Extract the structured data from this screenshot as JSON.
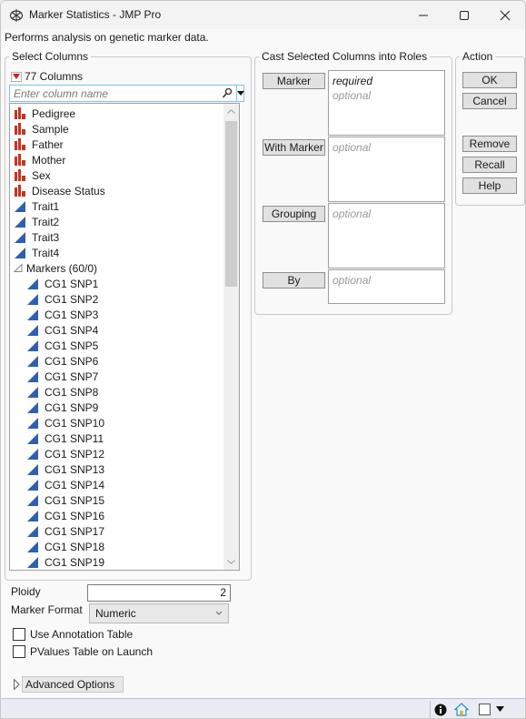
{
  "window": {
    "title": "Marker Statistics - JMP Pro",
    "icons": {
      "app": "jmp-dna-icon",
      "minimize": "minimize-icon",
      "maximize": "maximize-icon",
      "close": "close-icon"
    }
  },
  "subtitle": "Performs analysis on genetic marker data.",
  "select_columns": {
    "legend": "Select Columns",
    "count_label": "77 Columns",
    "search_placeholder": "Enter column name",
    "columns": [
      {
        "name": "Pedigree",
        "type": "nominal",
        "indent": 0
      },
      {
        "name": "Sample",
        "type": "nominal",
        "indent": 0
      },
      {
        "name": "Father",
        "type": "nominal",
        "indent": 0
      },
      {
        "name": "Mother",
        "type": "nominal",
        "indent": 0
      },
      {
        "name": "Sex",
        "type": "nominal",
        "indent": 0
      },
      {
        "name": "Disease Status",
        "type": "nominal",
        "indent": 0
      },
      {
        "name": "Trait1",
        "type": "continuous",
        "indent": 0
      },
      {
        "name": "Trait2",
        "type": "continuous",
        "indent": 0
      },
      {
        "name": "Trait3",
        "type": "continuous",
        "indent": 0
      },
      {
        "name": "Trait4",
        "type": "continuous",
        "indent": 0
      },
      {
        "name": "Markers (60/0)",
        "type": "group",
        "indent": 0
      },
      {
        "name": "CG1 SNP1",
        "type": "continuous",
        "indent": 1
      },
      {
        "name": "CG1 SNP2",
        "type": "continuous",
        "indent": 1
      },
      {
        "name": "CG1 SNP3",
        "type": "continuous",
        "indent": 1
      },
      {
        "name": "CG1 SNP4",
        "type": "continuous",
        "indent": 1
      },
      {
        "name": "CG1 SNP5",
        "type": "continuous",
        "indent": 1
      },
      {
        "name": "CG1 SNP6",
        "type": "continuous",
        "indent": 1
      },
      {
        "name": "CG1 SNP7",
        "type": "continuous",
        "indent": 1
      },
      {
        "name": "CG1 SNP8",
        "type": "continuous",
        "indent": 1
      },
      {
        "name": "CG1 SNP9",
        "type": "continuous",
        "indent": 1
      },
      {
        "name": "CG1 SNP10",
        "type": "continuous",
        "indent": 1
      },
      {
        "name": "CG1 SNP11",
        "type": "continuous",
        "indent": 1
      },
      {
        "name": "CG1 SNP12",
        "type": "continuous",
        "indent": 1
      },
      {
        "name": "CG1 SNP13",
        "type": "continuous",
        "indent": 1
      },
      {
        "name": "CG1 SNP14",
        "type": "continuous",
        "indent": 1
      },
      {
        "name": "CG1 SNP15",
        "type": "continuous",
        "indent": 1
      },
      {
        "name": "CG1 SNP16",
        "type": "continuous",
        "indent": 1
      },
      {
        "name": "CG1 SNP17",
        "type": "continuous",
        "indent": 1
      },
      {
        "name": "CG1 SNP18",
        "type": "continuous",
        "indent": 1
      },
      {
        "name": "CG1 SNP19",
        "type": "continuous",
        "indent": 1
      }
    ]
  },
  "cast_roles": {
    "legend": "Cast Selected Columns into Roles",
    "roles": [
      {
        "button": "Marker",
        "required": "required",
        "optional": "optional"
      },
      {
        "button": "With Marker",
        "required": "",
        "optional": "optional"
      },
      {
        "button": "Grouping",
        "required": "",
        "optional": "optional"
      },
      {
        "button": "By",
        "required": "",
        "optional": "optional"
      }
    ]
  },
  "action": {
    "legend": "Action",
    "buttons": [
      "OK",
      "Cancel",
      "Remove",
      "Recall",
      "Help"
    ]
  },
  "options": {
    "ploidy_label": "Ploidy",
    "ploidy_value": "2",
    "marker_format_label": "Marker Format",
    "marker_format_value": "Numeric",
    "use_annotation_label": "Use Annotation Table",
    "use_annotation_checked": false,
    "pvalues_label": "PValues Table on Launch",
    "pvalues_checked": false,
    "advanced_label": "Advanced Options"
  },
  "colors": {
    "nominal_icon": "#c8321e",
    "continuous_icon": "#2f5fb0",
    "red_triangle": "#d0182a",
    "search_border": "#7ec3e6"
  }
}
